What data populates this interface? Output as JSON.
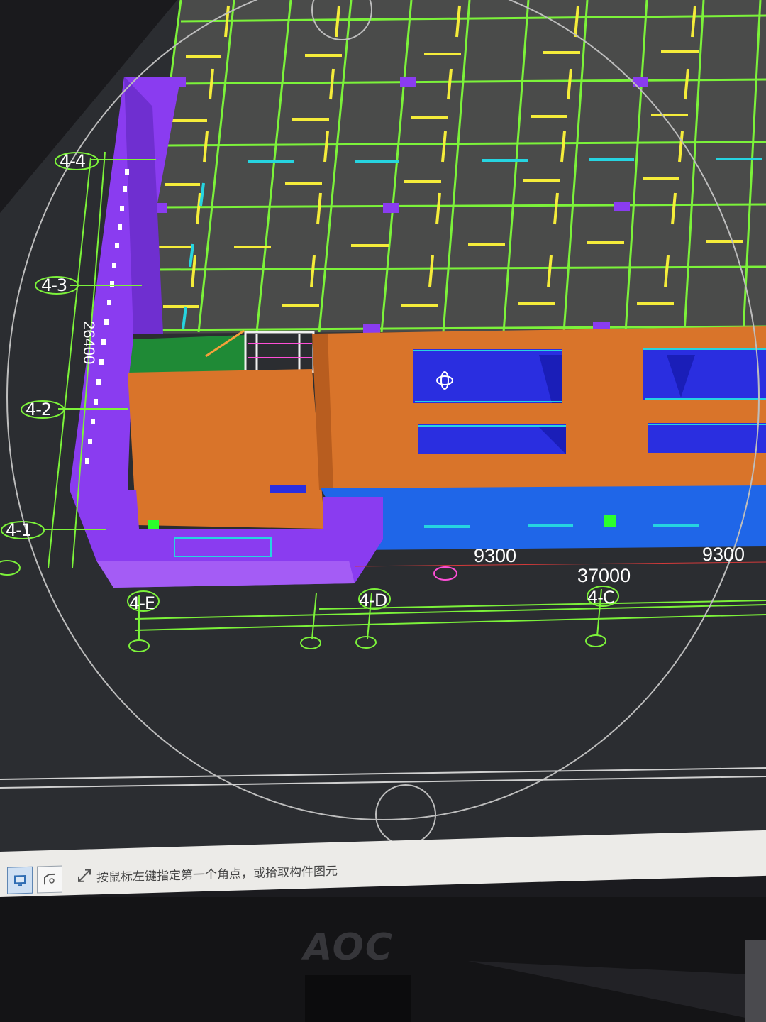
{
  "grid_axes": {
    "rows": [
      "4-4",
      "4-3",
      "4-2",
      "4-1"
    ],
    "columns": [
      "4-E",
      "4-D",
      "4-C"
    ]
  },
  "dimensions": {
    "bay_1": "9300",
    "bay_2": "9300",
    "overall": "37000",
    "vertical": "26400"
  },
  "status_bar": {
    "prompt": "按鼠标左键指定第一个角点，或拾取构件图元"
  },
  "monitor": {
    "brand": "AOC"
  },
  "colors": {
    "background": "#2b2d31",
    "grid_line": "#7cf23a",
    "beam": "#f5ec3a",
    "wall": "#d9742a",
    "slab": "#8a3cf0",
    "opening": "#2a2ee0",
    "window": "#26d4e0"
  },
  "icons": [
    "select-icon",
    "draw-icon",
    "corner-prompt-icon",
    "orbit-cursor-icon"
  ]
}
